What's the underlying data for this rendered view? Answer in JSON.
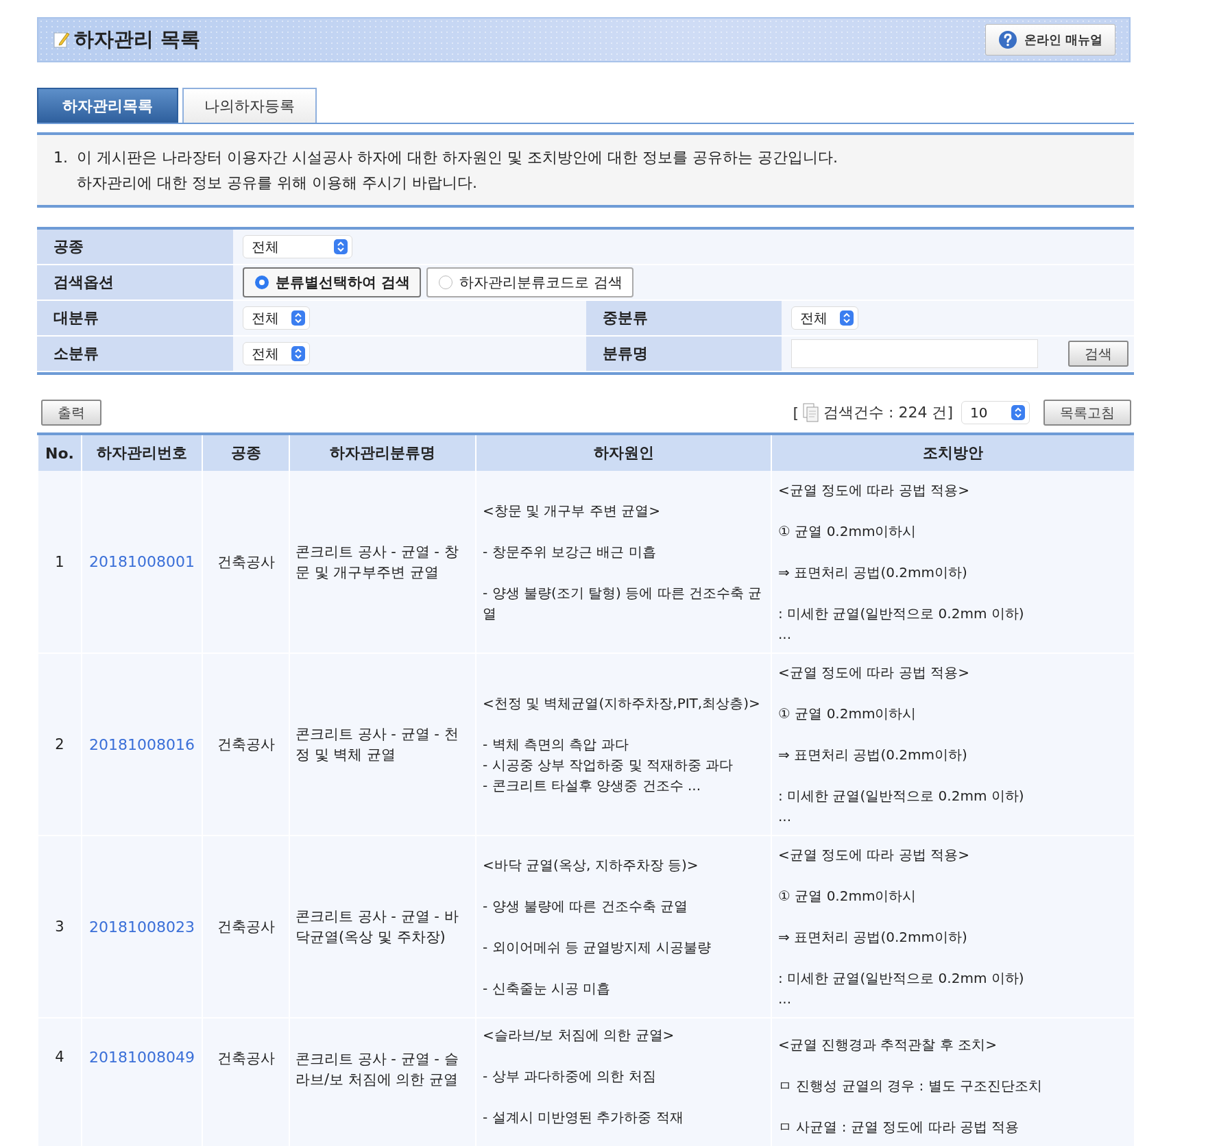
{
  "header": {
    "title": "하자관리 목록",
    "manual_button": "온라인 매뉴얼"
  },
  "tabs": [
    {
      "label": "하자관리목록",
      "selected": true
    },
    {
      "label": "나의하자등록",
      "selected": false
    }
  ],
  "notice": {
    "number": "1.",
    "lines": [
      "이 게시판은 나라장터 이용자간 시설공사 하자에 대한 하자원인 및 조치방안에 대한 정보를 공유하는 공간입니다.",
      "하자관리에 대한 정보 공유를 위해 이용해 주시기 바랍니다."
    ]
  },
  "search_form": {
    "work_type": {
      "label": "공종",
      "value": "전체"
    },
    "search_option": {
      "label": "검색옵션",
      "options": [
        {
          "label": "분류별선택하여 검색",
          "selected": true
        },
        {
          "label": "하자관리분류코드로 검색",
          "selected": false
        }
      ]
    },
    "major": {
      "label": "대분류",
      "value": "전체"
    },
    "middle": {
      "label": "중분류",
      "value": "전체"
    },
    "minor": {
      "label": "소분류",
      "value": "전체"
    },
    "name": {
      "label": "분류명"
    },
    "search_button": "검색"
  },
  "toolbar": {
    "print_button": "출력",
    "bracket": "[",
    "count": "검색건수 : 224 건]",
    "page_size": "10",
    "refresh_button": "목록고침"
  },
  "table": {
    "columns": [
      "No.",
      "하자관리번호",
      "공종",
      "하자관리분류명",
      "하자원인",
      "조치방안"
    ],
    "rows": [
      {
        "no": "1",
        "code": "20181008001",
        "work_type": "건축공사",
        "category": "콘크리트 공사 - 균열 - 창문 및 개구부주변 균열",
        "cause": [
          [
            "<창문 및 개구부 주변 균열>"
          ],
          [
            "- 창문주위 보강근 배근 미흡"
          ],
          [
            "- 양생 불량(조기 탈형) 등에 따른 건조수축 균열"
          ]
        ],
        "action": [
          [
            "<균열 정도에 따라 공법 적용>"
          ],
          [
            "① 균열 0.2mm이하시"
          ],
          [
            "⇒ 표면처리 공법(0.2mm이하)"
          ],
          [
            ": 미세한 균열(일반적으로 0.2mm 이하)",
            "..."
          ]
        ]
      },
      {
        "no": "2",
        "code": "20181008016",
        "work_type": "건축공사",
        "category": "콘크리트 공사 - 균열 - 천정 및 벽체 균열",
        "cause": [
          [
            "<천정 및 벽체균열(지하주차장,PIT,최상층)>"
          ],
          [
            "- 벽체 측면의 측압 과다",
            "- 시공중 상부 작업하중 및 적재하중 과다",
            "- 콘크리트 타설후 양생중 건조수 ..."
          ]
        ],
        "action": [
          [
            "<균열 정도에 따라 공법 적용>"
          ],
          [
            "① 균열 0.2mm이하시"
          ],
          [
            "⇒ 표면처리 공법(0.2mm이하)"
          ],
          [
            ": 미세한 균열(일반적으로 0.2mm 이하)",
            "..."
          ]
        ]
      },
      {
        "no": "3",
        "code": "20181008023",
        "work_type": "건축공사",
        "category": "콘크리트 공사 - 균열 - 바닥균열(옥상 및 주차장)",
        "cause": [
          [
            "<바닥 균열(옥상, 지하주차장 등)>"
          ],
          [
            "- 양생 불량에 따른 건조수축 균열"
          ],
          [
            "- 외이어메쉬 등 균열방지제 시공불량"
          ],
          [
            "- 신축줄눈 시공 미흡"
          ]
        ],
        "action": [
          [
            "<균열 정도에 따라 공법 적용>"
          ],
          [
            "① 균열 0.2mm이하시"
          ],
          [
            "⇒ 표면처리 공법(0.2mm이하)"
          ],
          [
            ": 미세한 균열(일반적으로 0.2mm 이하)",
            "..."
          ]
        ]
      },
      {
        "no": "4",
        "code": "20181008049",
        "work_type": "건축공사",
        "category": "콘크리트 공사 - 균열 - 슬라브/보 처짐에 의한 균열",
        "cause": [
          [
            "<슬라브/보 처짐에 의한 균열>"
          ],
          [
            "- 상부 과다하중에 의한 처짐"
          ],
          [
            "- 설계시 미반영된 추가하중 적재"
          ]
        ],
        "action": [
          [
            "<균열 진행경과 추적관찰 후 조치>"
          ],
          [
            "ㅁ 진행성 균열의 경우 : 별도 구조진단조치"
          ],
          [
            "ㅁ 사균열 : 균열 정도에 따라 공법 적용"
          ]
        ]
      }
    ]
  }
}
